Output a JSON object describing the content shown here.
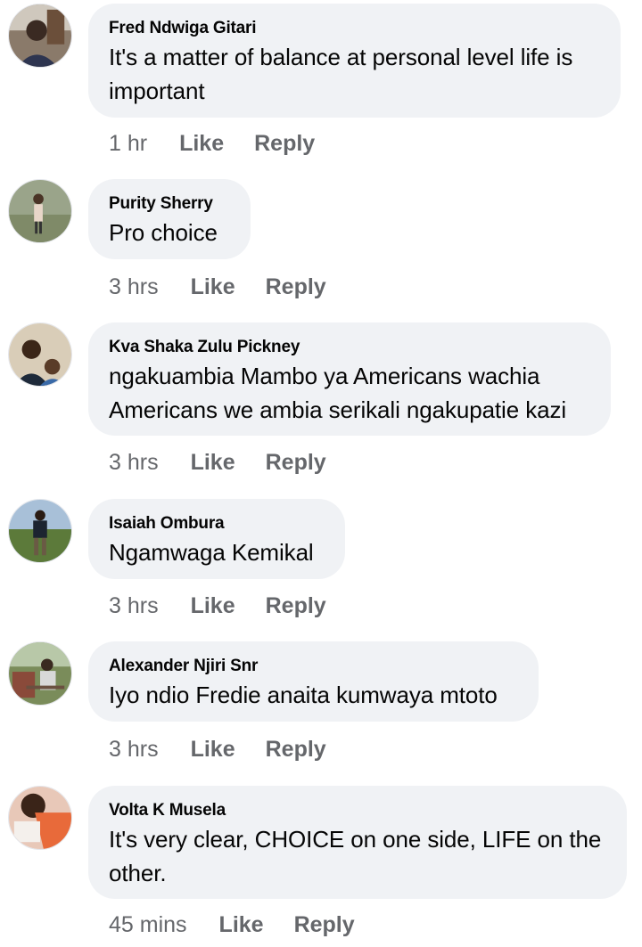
{
  "comments": [
    {
      "author": "Fred Ndwiga Gitari",
      "text": "It's a matter of balance at personal level life is important",
      "time": "1 hr",
      "like_label": "Like",
      "reply_label": "Reply"
    },
    {
      "author": "Purity Sherry",
      "text": "Pro choice",
      "time": "3 hrs",
      "like_label": "Like",
      "reply_label": "Reply"
    },
    {
      "author": "Kva Shaka Zulu Pickney",
      "text": "ngakuambia Mambo ya Americans wachia Americans we ambia serikali ngakupatie kazi",
      "time": "3 hrs",
      "like_label": "Like",
      "reply_label": "Reply"
    },
    {
      "author": "Isaiah Ombura",
      "text": "Ngamwaga Kemikal",
      "time": "3 hrs",
      "like_label": "Like",
      "reply_label": "Reply"
    },
    {
      "author": "Alexander Njiri Snr",
      "text": "Iyo ndio Fredie anaita kumwaya mtoto",
      "time": "3 hrs",
      "like_label": "Like",
      "reply_label": "Reply"
    },
    {
      "author": "Volta K Musela",
      "text": "It's very clear, CHOICE on one side, LIFE on the other.",
      "time": "45 mins",
      "like_label": "Like",
      "reply_label": "Reply"
    }
  ],
  "colors": {
    "bubble": "#f0f2f5",
    "meta_text": "#65676b",
    "primary_text": "#050505"
  }
}
